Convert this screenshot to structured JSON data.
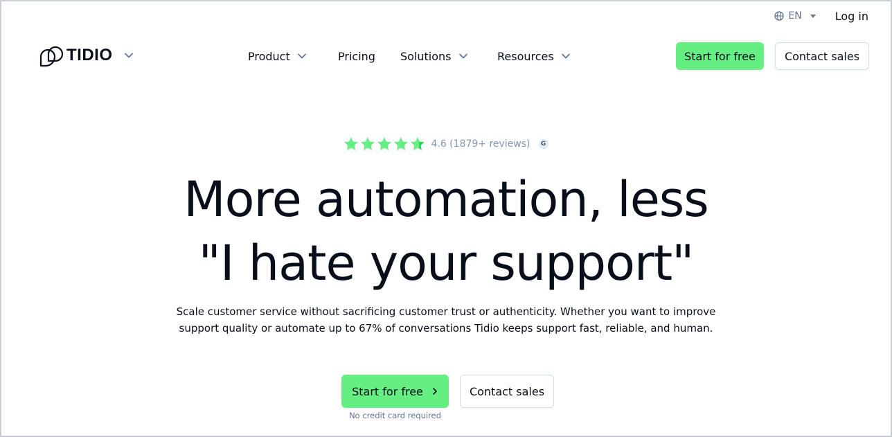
{
  "utility": {
    "language": "EN",
    "login": "Log in"
  },
  "header": {
    "logo_text": "TIDIO",
    "nav": [
      {
        "label": "Product",
        "has_dropdown": true
      },
      {
        "label": "Pricing",
        "has_dropdown": false
      },
      {
        "label": "Solutions",
        "has_dropdown": true
      },
      {
        "label": "Resources",
        "has_dropdown": true
      }
    ],
    "start_button": "Start for free",
    "contact_button": "Contact sales"
  },
  "hero": {
    "rating_value": 4.6,
    "rating_max": 5,
    "rating_text": "4.6 (1879+ reviews)",
    "rating_badge": "G",
    "headline_line1": "More automation, less",
    "headline_line2": "\"I hate your support\"",
    "subtext_line1": "Scale customer service without sacrificing customer trust or authenticity. Whether you want to improve",
    "subtext_line2": "support quality or automate up to 67% of conversations Tidio keeps support fast, reliable, and human.",
    "cta_start": "Start for free",
    "cta_contact": "Contact sales",
    "cta_note": "No credit card required"
  },
  "colors": {
    "accent_green": "#65ef82",
    "star_green": "#65ef82",
    "text_dark": "#080f1a",
    "text_muted": "#647491",
    "border": "#d3dbe5"
  },
  "icons": {
    "language": "globe-icon",
    "dropdown": "chevron-down-icon",
    "cta_arrow": "chevron-right-icon",
    "rating": "star-icon"
  }
}
